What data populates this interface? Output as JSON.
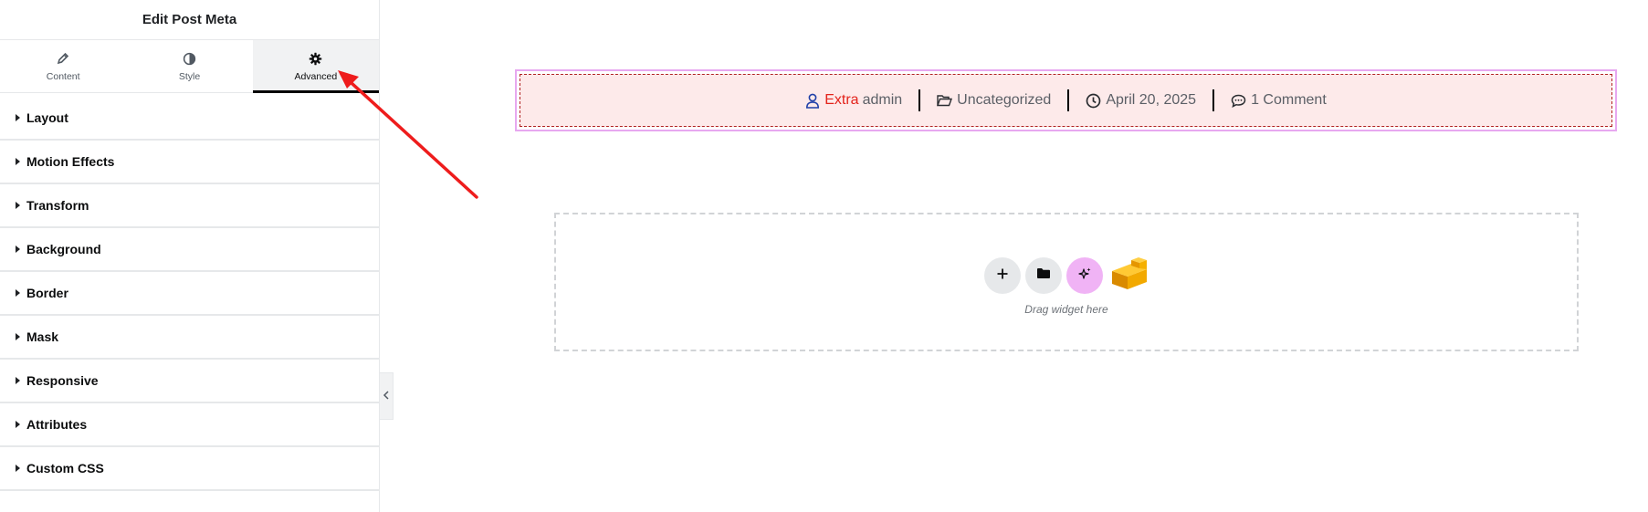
{
  "panel": {
    "title": "Edit Post Meta",
    "tabs": [
      {
        "label": "Content",
        "icon": "pencil-icon",
        "active": false
      },
      {
        "label": "Style",
        "icon": "half-circle-icon",
        "active": false
      },
      {
        "label": "Advanced",
        "icon": "gear-icon",
        "active": true
      }
    ],
    "sections": [
      {
        "label": "Layout"
      },
      {
        "label": "Motion Effects"
      },
      {
        "label": "Transform"
      },
      {
        "label": "Background"
      },
      {
        "label": "Border"
      },
      {
        "label": "Mask"
      },
      {
        "label": "Responsive"
      },
      {
        "label": "Attributes"
      },
      {
        "label": "Custom CSS"
      }
    ],
    "collapse_icon": "chevron-left-icon"
  },
  "post_meta": {
    "author_prefix": "Extra",
    "author": "admin",
    "category": "Uncategorized",
    "date": "April 20, 2025",
    "comments": "1 Comment",
    "colors": {
      "prefix": "#e3231b",
      "author_icon": "#1f3fa8",
      "background": "#fdeaea",
      "outline": "#e7a8f0"
    }
  },
  "dropzone": {
    "hint": "Drag widget here",
    "buttons": [
      "plus-icon",
      "folder-icon",
      "ai-sparkle-icon",
      "template-cube-icon"
    ]
  },
  "annotation": {
    "color": "#ee1c1c",
    "points_to": "Advanced tab"
  }
}
